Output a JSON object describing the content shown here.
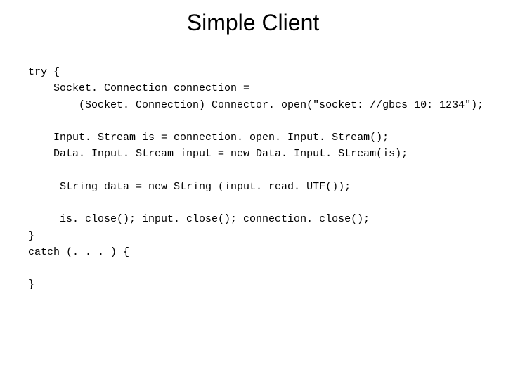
{
  "slide": {
    "title": "Simple Client",
    "code": "try {\n    Socket. Connection connection =\n        (Socket. Connection) Connector. open(\"socket: //gbcs 10: 1234\");\n\n    Input. Stream is = connection. open. Input. Stream();\n    Data. Input. Stream input = new Data. Input. Stream(is);\n\n     String data = new String (input. read. UTF());\n\n     is. close(); input. close(); connection. close();\n}\ncatch (. . . ) {\n\n}"
  }
}
